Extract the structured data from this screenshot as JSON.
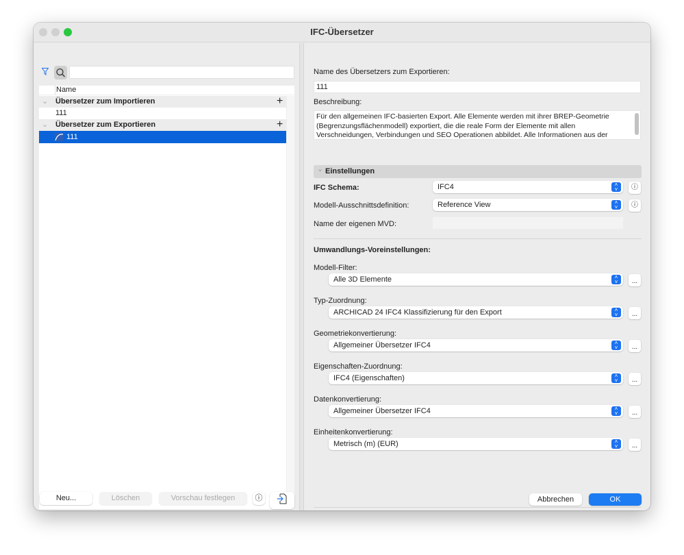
{
  "window": {
    "title": "IFC-Übersetzer"
  },
  "left": {
    "search": {
      "value": "",
      "placeholder": ""
    },
    "column_header": "Name",
    "groups": [
      {
        "label": "Übersetzer zum Importieren",
        "items": [
          "111"
        ]
      },
      {
        "label": "Übersetzer zum Exportieren",
        "items": [
          "111"
        ]
      }
    ],
    "buttons": {
      "new": "Neu...",
      "delete": "Löschen",
      "preview": "Vorschau festlegen"
    }
  },
  "right": {
    "name_label": "Name des Übersetzers zum Exportieren:",
    "name_value": "111",
    "desc_label": "Beschreibung:",
    "desc_value": "Für den allgemeinen IFC-basierten Export. Alle Elemente werden mit ihrer BREP-Geometrie (Begrenzungsflächenmodell) exportiert, die die reale Form der Elemente mit allen Verschneidungen, Verbindungen und SEO Operationen abbildet. Alle Informationen aus der Modell werden exportiert.",
    "settings_header": "Einstellungen",
    "schema_label": "IFC Schema:",
    "schema_value": "IFC4",
    "mvd_label": "Modell-Ausschnittsdefinition:",
    "mvd_value": "Reference View",
    "custom_mvd_label": "Name der eigenen MVD:",
    "custom_mvd_value": "",
    "presets_header": "Umwandlungs-Voreinstellungen:",
    "presets": [
      {
        "label": "Modell-Filter:",
        "value": "Alle 3D Elemente"
      },
      {
        "label": "Typ-Zuordnung:",
        "value": "ARCHICAD 24 IFC4 Klassifizierung für den Export"
      },
      {
        "label": "Geometriekonvertierung:",
        "value": "Allgemeiner Übersetzer IFC4"
      },
      {
        "label": "Eigenschaften-Zuordnung:",
        "value": "IFC4 (Eigenschaften)"
      },
      {
        "label": "Datenkonvertierung:",
        "value": "Allgemeiner Übersetzer IFC4"
      },
      {
        "label": "Einheitenkonvertierung:",
        "value": "Metrisch (m) (EUR)"
      }
    ],
    "more_label": "...",
    "cancel": "Abbrechen",
    "ok": "OK"
  },
  "colors": {
    "accent": "#1d72f0",
    "selection": "#0a63d8",
    "close": "#d0d0d0",
    "zoom": "#2ac840"
  }
}
